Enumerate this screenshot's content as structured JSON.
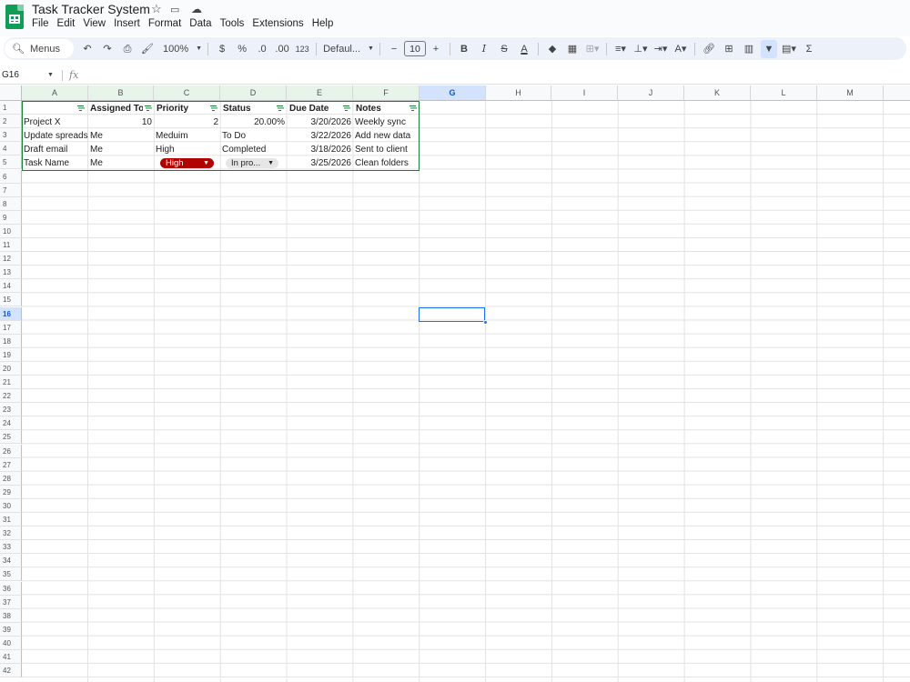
{
  "app": {
    "title": "Task Tracker System",
    "menu": [
      "File",
      "Edit",
      "View",
      "Insert",
      "Format",
      "Data",
      "Tools",
      "Extensions",
      "Help"
    ]
  },
  "toolbar": {
    "search": "Menus",
    "zoom": "100%",
    "currency": "$",
    "percent": "%",
    "dec_decrease": ".0",
    "dec_increase": ".00",
    "number_format": "123",
    "font": "Defaul...",
    "font_size": "10",
    "bold": "B",
    "italic": "I",
    "underline_a": "A"
  },
  "formula_bar": {
    "cell_ref": "G16",
    "fx": "fx"
  },
  "columns": [
    "A",
    "B",
    "C",
    "D",
    "E",
    "F",
    "G",
    "H",
    "I",
    "J",
    "K",
    "L",
    "M"
  ],
  "rows": [
    "1",
    "2",
    "3",
    "4",
    "5",
    "6",
    "7",
    "8",
    "9",
    "10",
    "11",
    "12",
    "13",
    "14",
    "15",
    "16",
    "17",
    "18",
    "19",
    "20",
    "21",
    "22",
    "23",
    "24",
    "25",
    "26",
    "27",
    "28",
    "29",
    "30",
    "31",
    "32",
    "33",
    "34",
    "35",
    "36",
    "37",
    "38",
    "39",
    "40",
    "41",
    "42"
  ],
  "headers": [
    "",
    "Assigned To",
    "Priority",
    "Status",
    "Due Date",
    "Notes"
  ],
  "data": [
    [
      "Project X",
      "10",
      "2",
      "20.00%",
      "3/20/2026",
      "Weekly sync"
    ],
    [
      "Update spreadsheet",
      "Me",
      "Meduim",
      "To Do",
      "3/22/2026",
      "Add new data"
    ],
    [
      "Draft email",
      "Me",
      "High",
      "Completed",
      "3/18/2026",
      "Sent to client"
    ],
    [
      "Task Name",
      "Me",
      "High",
      "In pro...",
      "3/25/2026",
      "Clean folders"
    ]
  ],
  "colors": {
    "chip_high": "#b10202",
    "selection": "#1a73e8",
    "filter_border": "#188038"
  }
}
